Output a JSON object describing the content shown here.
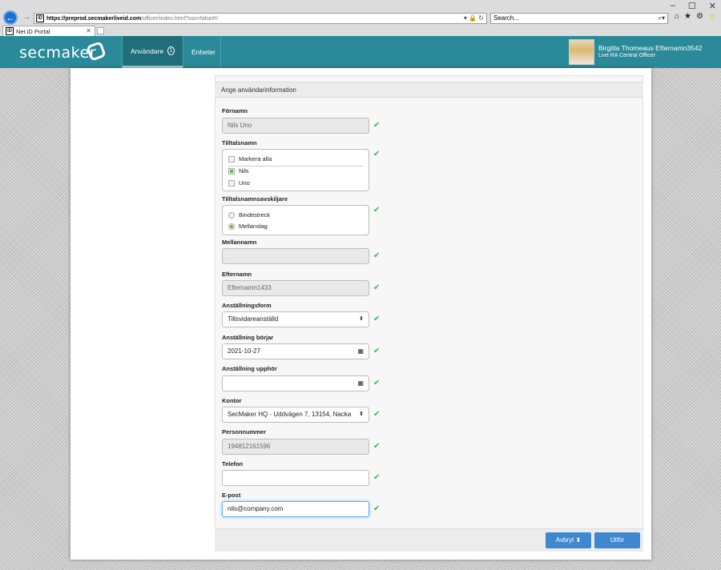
{
  "browser": {
    "url_domain": "https://preprod.secmakerliveid.com",
    "url_rest": "/officer/index.html?sso=false#!/",
    "search_placeholder": "Search...",
    "tab_title": "Net iD Portal",
    "site_icon_text": "iD"
  },
  "app": {
    "logo_text": "secmaker",
    "nav": {
      "users_label": "Användare",
      "users_badge": "1",
      "units_label": "Enheter"
    },
    "user": {
      "name": "Birgitta Thomeaus Efternamn3542",
      "role": "Live RA Central Officer"
    }
  },
  "form": {
    "title": "Ange användarinformation",
    "firstname": {
      "label": "Förnamn",
      "value": "Nils Uno"
    },
    "given_names": {
      "label": "Tilltalsnamn",
      "select_all": "Markera alla",
      "options": [
        {
          "label": "Nils",
          "checked": true
        },
        {
          "label": "Uno",
          "checked": false
        }
      ]
    },
    "separator": {
      "label": "Tilltalsnamnsavskiljare",
      "options": [
        {
          "label": "Bindestreck",
          "selected": false
        },
        {
          "label": "Mellanslag",
          "selected": true
        }
      ]
    },
    "middlename": {
      "label": "Mellannamn",
      "value": ""
    },
    "lastname": {
      "label": "Efternamn",
      "value": "Efternamn1433"
    },
    "employment_form": {
      "label": "Anställningsform",
      "value": "Tillsvidareanställd"
    },
    "employment_start": {
      "label": "Anställning börjar",
      "value": "2021-10-27"
    },
    "employment_end": {
      "label": "Anställning upphör",
      "value": ""
    },
    "office": {
      "label": "Kontor",
      "value": "SecMaker HQ - Uddvägen 7, 13154, Nacka"
    },
    "personal_number": {
      "label": "Personnummer",
      "value": "194812161596"
    },
    "phone": {
      "label": "Telefon",
      "value": ""
    },
    "email": {
      "label": "E-post",
      "value": "nils@company.com"
    }
  },
  "actions": {
    "cancel_label": "Avbryt",
    "submit_label": "Utför"
  },
  "colors": {
    "header": "#2a8a9a",
    "button": "#3f88d0",
    "valid_check": "#4cae4c"
  }
}
